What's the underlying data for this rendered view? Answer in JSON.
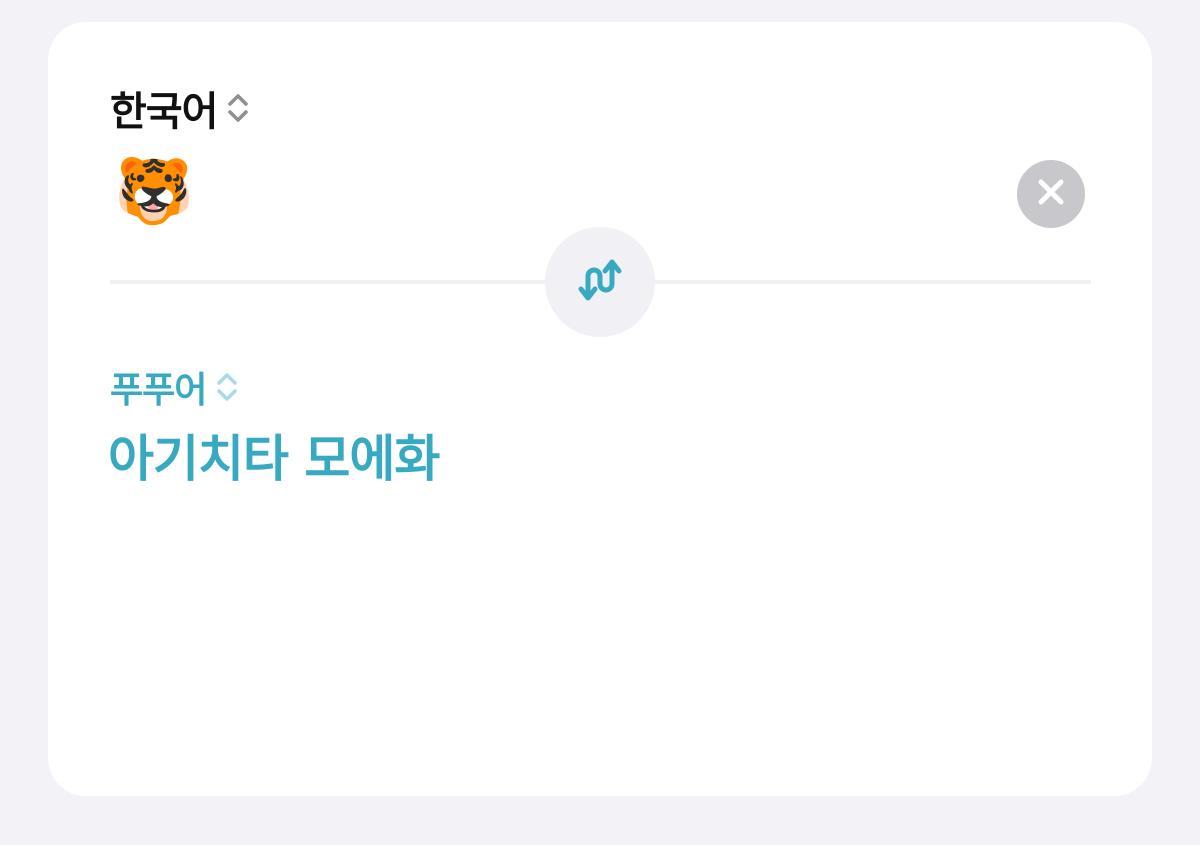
{
  "source": {
    "language": "한국어",
    "text": "🐯",
    "language_icon": "chevron-up-down-icon"
  },
  "target": {
    "language": "푸푸어",
    "translation": "아기치타 모에화",
    "language_icon": "chevron-up-down-icon"
  },
  "actions": {
    "clear_icon": "close-icon",
    "swap_icon": "swap-arrows-icon"
  },
  "colors": {
    "background": "#f2f2f7",
    "card": "#ffffff",
    "accent": "#37a9c1",
    "clear_button": "#c7c7cc",
    "swap_button": "#f0f0f5"
  }
}
